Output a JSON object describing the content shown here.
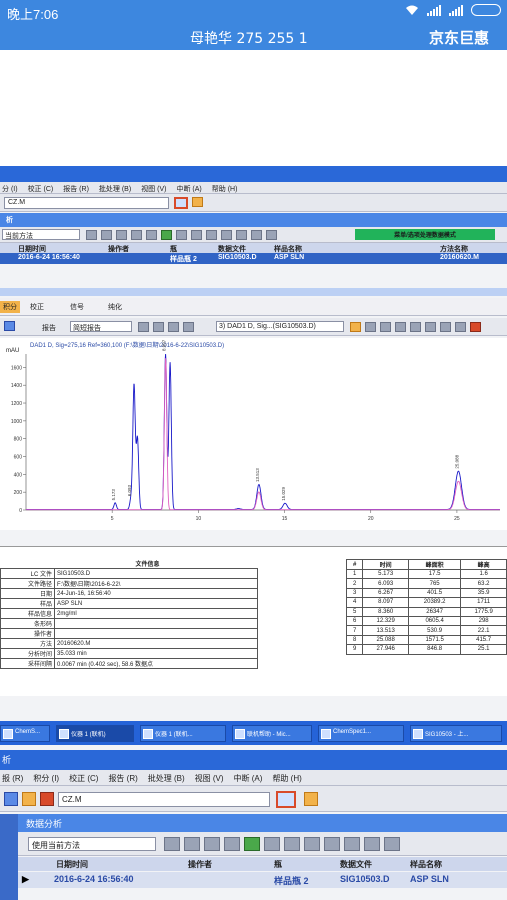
{
  "status_bar": {
    "time": "晚上7:06"
  },
  "chat_header": {
    "title": "母艳华  275  255 1",
    "action": "京东巨惠"
  },
  "top_window": {
    "menu": [
      "分 (I)",
      "校正 (C)",
      "报告 (R)",
      "批处理 (B)",
      "视图 (V)",
      "中断 (A)",
      "帮助 (H)"
    ],
    "method_field": "CZ.M",
    "panel_title": "析",
    "method_select": "当前方法",
    "green_button": "菜单/选项处理数据模式",
    "table_headers": [
      "日期时间",
      "操作者",
      "瓶",
      "数据文件",
      "样品名称",
      "方法名称"
    ],
    "row": {
      "datetime": "2016-6-24 16:56:40",
      "vial": "样品瓶 2",
      "file": "SIG10503.D",
      "sample": "ASP SLN",
      "method": "20160620.M"
    }
  },
  "chromatogram": {
    "tabs": [
      "积分",
      "校正",
      "信号",
      "纯化"
    ],
    "report_label": "报告",
    "report_select": "简短报告",
    "signal_select": "3) DAD1 D, Sig...(SIG10503.D)",
    "plot_title": "DAD1 D, Sig=275,16 Ref=360,100 (F:\\数据\\日期\\2016-6-22\\SIG10503.D)",
    "unit": "mAU"
  },
  "chart_data": {
    "type": "line",
    "title": "DAD1 D, Sig=275,16 Ref=360,100 (F:\\数据\\日期\\2016-6-22\\SIG10503.D)",
    "xlabel": "",
    "ylabel": "mAU",
    "xlim": [
      0,
      27.5
    ],
    "ylim": [
      0,
      1750
    ],
    "yticks": [
      0,
      200,
      400,
      600,
      800,
      1000,
      1200,
      1400,
      1600
    ],
    "xticks": [
      5,
      10,
      15,
      20,
      25
    ],
    "series": [
      {
        "color": "#1818c8",
        "peaks": [
          {
            "rt": 5.173,
            "height": 75,
            "label": "5.173"
          },
          {
            "rt": 6.093,
            "height": 120,
            "label": "6.093"
          },
          {
            "rt": 6.267,
            "height": 1400,
            "label": ""
          },
          {
            "rt": 6.467,
            "height": 800,
            "label": ""
          },
          {
            "rt": 8.097,
            "height": 1750,
            "label": "8.097"
          },
          {
            "rt": 8.36,
            "height": 1650,
            "label": ""
          },
          {
            "rt": 12.329,
            "height": 10,
            "label": ""
          },
          {
            "rt": 13.513,
            "height": 280,
            "label": "13.513"
          },
          {
            "rt": 15.029,
            "height": 70,
            "label": "15.029"
          },
          {
            "rt": 25.088,
            "height": 430,
            "label": "25.088"
          }
        ]
      },
      {
        "color": "#e060c0",
        "peaks": [
          {
            "rt": 8.1,
            "height": 1700,
            "label": ""
          },
          {
            "rt": 13.51,
            "height": 200,
            "label": ""
          },
          {
            "rt": 25.09,
            "height": 320,
            "label": ""
          }
        ]
      }
    ]
  },
  "info_table": {
    "title": "文件信息",
    "rows": [
      [
        "LC 文件",
        "SIG10503.D"
      ],
      [
        "文件路径",
        "F:\\数据\\日期\\2016-6-22\\"
      ],
      [
        "日期",
        "24-Jun-16, 16:56:40"
      ],
      [
        "样品",
        "ASP SLN"
      ],
      [
        "样品信息",
        "2mg/ml"
      ],
      [
        "条形码",
        ""
      ],
      [
        "操作者",
        ""
      ],
      [
        "方法",
        "20160620.M"
      ],
      [
        "分析时间",
        "35.033 min"
      ],
      [
        "采样间隔",
        "0.0067 min (0.402 sec), 58.6 数据点"
      ]
    ]
  },
  "peak_table": {
    "headers": [
      "#",
      "时间",
      "峰面积",
      "峰高"
    ],
    "rows": [
      [
        "1",
        "5.173",
        "17.5",
        "1.6"
      ],
      [
        "2",
        "6.093",
        "765",
        "63.2"
      ],
      [
        "3",
        "6.267",
        "401.5",
        "35.9"
      ],
      [
        "4",
        "8.097",
        "20389.2",
        "1711"
      ],
      [
        "5",
        "8.360",
        "26347",
        "1775.9"
      ],
      [
        "6",
        "12.329",
        "0605.4",
        "298"
      ],
      [
        "7",
        "13.513",
        "530.9",
        "22.1"
      ],
      [
        "8",
        "25.088",
        "1571.5",
        "415.7"
      ],
      [
        "9",
        "27.946",
        "846.8",
        "25.1"
      ]
    ]
  },
  "taskbar": [
    {
      "label": "ChemS..."
    },
    {
      "label": "仪器 1 (联机)"
    },
    {
      "label": "仪器 1 (联机..."
    },
    {
      "label": "联机帮助 - Mic..."
    },
    {
      "label": "ChemSpec1..."
    },
    {
      "label": "SIG10503 - 上..."
    }
  ],
  "bottom_window": {
    "title": "析",
    "menu": [
      "报 (R)",
      "积分 (I)",
      "校正 (C)",
      "报告 (R)",
      "批处理 (B)",
      "视图 (V)",
      "中断 (A)",
      "帮助 (H)"
    ],
    "method_field": "CZ.M",
    "panel_title": "数据分析",
    "method_select": "使用当前方法",
    "table_headers": [
      "日期时间",
      "操作者",
      "瓶",
      "数据文件",
      "样品名称"
    ],
    "row": {
      "datetime": "2016-6-24 16:56:40",
      "vial": "样品瓶 2",
      "file": "SIG10503.D",
      "sample": "ASP SLN"
    }
  }
}
